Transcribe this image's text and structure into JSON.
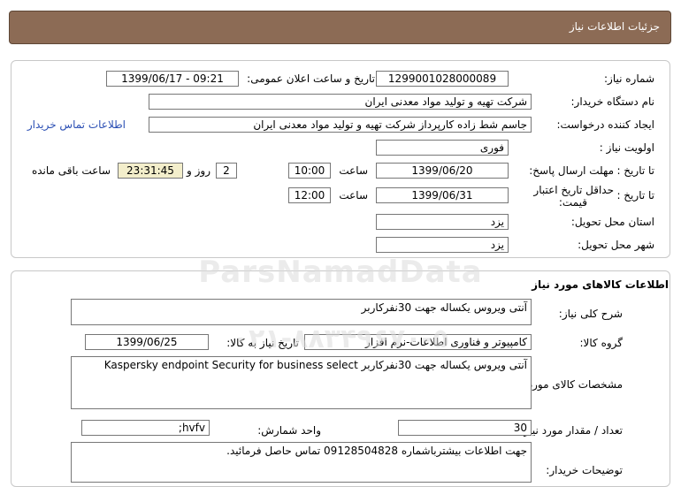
{
  "header": {
    "title": "جزئیات اطلاعات نیاز"
  },
  "info": {
    "need_number_label": "شماره نیاز:",
    "need_number": "1299001028000089",
    "announce_label": "تاریخ و ساعت اعلان عمومی:",
    "announce_value": "1399/06/17 - 09:21",
    "buyer_org_label": "نام دستگاه خریدار:",
    "buyer_org": "شرکت تهیه و تولید مواد معدنی ایران",
    "creator_label": "ایجاد کننده درخواست:",
    "creator": "جاسم شط زاده کارپرداز شرکت تهیه و تولید مواد معدنی ایران",
    "contact_link": "اطلاعات تماس خریدار",
    "priority_label": "اولویت نیاز :",
    "priority": "فوری",
    "deadline_label": "مهلت ارسال پاسخ:",
    "until_date_label": "تا تاریخ :",
    "deadline_date": "1399/06/20",
    "time_label": "ساعت",
    "deadline_time": "10:00",
    "days": "2",
    "days_label": "روز و",
    "remaining_time": "23:31:45",
    "remaining_label": "ساعت باقی مانده",
    "validity_label_1": "حداقل تاریخ اعتبار",
    "validity_label_2": "قیمت:",
    "validity_date": "1399/06/31",
    "validity_time": "12:00",
    "province_label": "استان محل تحویل:",
    "province": "یزد",
    "city_label": "شهر محل تحویل:",
    "city": "یزد"
  },
  "goods": {
    "section_title": "اطلاعات کالاهای مورد نیاز",
    "summary_label": "شرح کلی نیاز:",
    "summary": "آنتی ویروس یکساله  جهت 30نفرکاربر",
    "group_label": "گروه کالا:",
    "group": "کامپیوتر و فناوری اطلاعات-نرم افزار",
    "need_date_label": "تاریخ نیاز به کالا:",
    "need_date": "1399/06/25",
    "specs_label": "مشخصات کالای مورد نیاز:",
    "specs": "آنتی ویروس یکساله  جهت 30نفرکاربر Kaspersky endpoint Security for business select",
    "qty_label": "تعداد / مقدار مورد نیاز:",
    "qty": "30",
    "unit_label": "واحد شمارش:",
    "unit": "hvfv;",
    "buyer_notes_label": "توضیحات خریدار:",
    "buyer_notes": "جهت اطلاعات بیشترباشماره 09128504828 تماس حاصل فرمائید."
  },
  "watermark": {
    "line1": "ParsNamadData",
    "line2": "۰۲۱-۸۸۳۴۹۶۷۰-۵"
  }
}
